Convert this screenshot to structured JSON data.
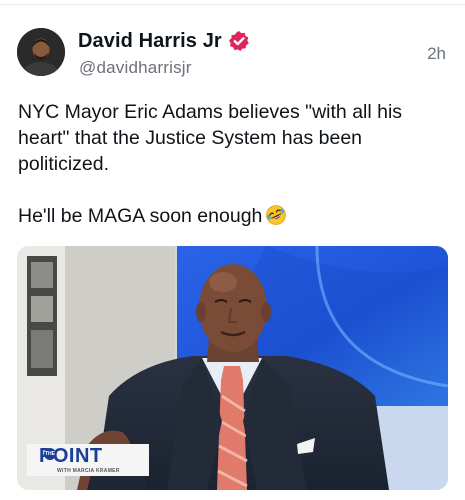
{
  "author": {
    "display_name": "David Harris Jr",
    "handle": "@davidharrisjr",
    "verified": true,
    "avatar_icon": "user-avatar"
  },
  "timestamp": "2h",
  "post": {
    "line1": "NYC Mayor Eric Adams believes \"with all his",
    "line1b": "heart\" that the Justice System has been",
    "line1c": "politicized.",
    "line2": "He'll be MAGA soon enough",
    "emoji_icon": "rolling-laughing-emoji-icon"
  },
  "media": {
    "show_name": "POINT",
    "show_prefix": "THE",
    "host_credit": "WITH MARCIA KRAMER"
  },
  "colors": {
    "verified_badge": "#e0245e",
    "show_brand": "#1a3f98",
    "studio_blue": "#1e55d8"
  }
}
